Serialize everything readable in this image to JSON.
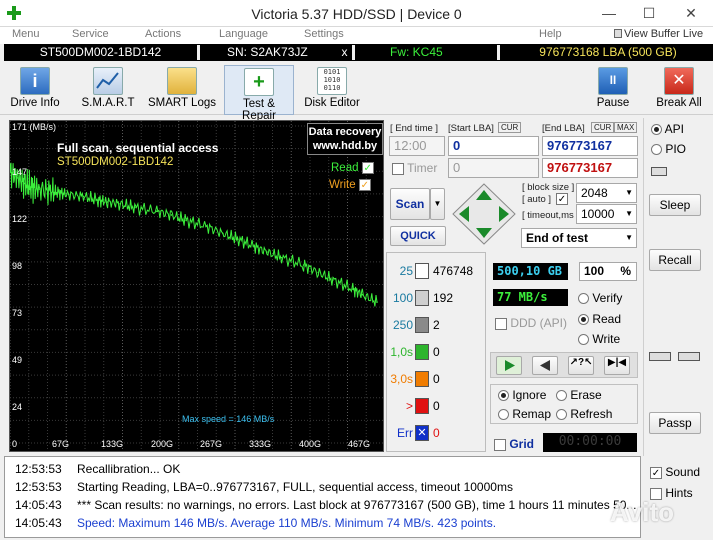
{
  "window": {
    "title": "Victoria 5.37 HDD/SSD | Device 0",
    "minimize": "—",
    "maximize": "☐",
    "close": "✕"
  },
  "menu": [
    "Menu",
    "Service",
    "Actions",
    "Language",
    "Settings",
    "Help"
  ],
  "view_buffer": "View Buffer Live",
  "device": {
    "model": "ST500DM002-1BD142",
    "serial": "SN: S2AK73JZ",
    "close": "x",
    "fw": "Fw: KC45",
    "lba": "976773168 LBA (500 GB)"
  },
  "toolbar": {
    "drive_info": "Drive Info",
    "smart": "S.M.A.R.T",
    "smart_logs": "SMART Logs",
    "test_repair": "Test & Repair",
    "disk_editor": "Disk Editor",
    "pause": "Pause",
    "break_all": "Break All"
  },
  "graph": {
    "y_top": "171 (MB/s)",
    "yticks": [
      "147",
      "122",
      "98",
      "73",
      "49",
      "24"
    ],
    "xticks": [
      "0",
      "67G",
      "133G",
      "200G",
      "267G",
      "333G",
      "400G",
      "467G"
    ],
    "title": "Full scan, sequential access",
    "model": "ST500DM002-1BD142",
    "badge_line1": "Data recovery",
    "badge_line2": "www.hdd.by",
    "read_label": "Read",
    "write_label": "Write",
    "max_speed": "Max speed = 146 MB/s"
  },
  "chart_data": {
    "type": "line",
    "title": "Full scan, sequential access",
    "xlabel": "",
    "ylabel": "MB/s",
    "xlim": [
      0,
      500
    ],
    "ylim": [
      0,
      171
    ],
    "series": [
      {
        "name": "Read",
        "x": [
          0,
          10,
          20,
          30,
          40,
          55,
          67,
          80,
          100,
          120,
          133,
          150,
          170,
          200,
          220,
          240,
          267,
          290,
          310,
          333,
          350,
          370,
          400,
          420,
          440,
          467,
          480,
          500
        ],
        "values": [
          146,
          143,
          140,
          138,
          137,
          136,
          135,
          134,
          133,
          131,
          130,
          129,
          127,
          125,
          123,
          120,
          117,
          113,
          110,
          106,
          103,
          100,
          96,
          92,
          88,
          83,
          80,
          76
        ]
      }
    ]
  },
  "lba_panel": {
    "end_time_label": "[ End time ]",
    "start_lba_label": "[Start LBA]",
    "cur_label": "CUR",
    "end_lba_label": "[End LBA]",
    "max_label": "MAX",
    "end_time": "12:00",
    "start_lba": "0",
    "end_lba": "976773167",
    "timer_label": "Timer",
    "timer_value": "0",
    "current_lba": "976773167",
    "block_size_label": "[ block size ]",
    "auto_label": "[ auto ]",
    "timeout_label": "[ timeout,ms ]",
    "block_size": "2048",
    "timeout": "10000",
    "end_action": "End of test"
  },
  "scan": {
    "scan": "Scan",
    "quick": "QUICK"
  },
  "counters": [
    {
      "label": "25",
      "value": "476748",
      "color": "#ffffff"
    },
    {
      "label": "100",
      "value": "192",
      "color": "#cfcfcf"
    },
    {
      "label": "250",
      "value": "2",
      "color": "#8a8a8a"
    },
    {
      "label": "1,0s",
      "value": "0",
      "color": "#2db52d"
    },
    {
      "label": "3,0s",
      "value": "0",
      "color": "#f07c00"
    },
    {
      "label": ">",
      "value": "0",
      "color": "#e01010"
    },
    {
      "label": "Err",
      "value": "0",
      "color": "#1030c8"
    }
  ],
  "status": {
    "size": "500,10 GB",
    "percent": "100",
    "pct_sign": "%",
    "speed": "77 MB/s",
    "ddd": "DDD (API)"
  },
  "mode": {
    "verify": "Verify",
    "read": "Read",
    "write": "Write"
  },
  "actions": {
    "ignore": "Ignore",
    "erase": "Erase",
    "remap": "Remap",
    "refresh": "Refresh"
  },
  "grid": {
    "label": "Grid",
    "time": "00:00:00"
  },
  "right_panel": {
    "api": "API",
    "pio": "PIO",
    "sleep": "Sleep",
    "recall": "Recall",
    "passp": "Passp",
    "sound": "Sound",
    "hints": "Hints"
  },
  "log": [
    {
      "time": "12:53:53",
      "text": "Recallibration... OK",
      "color": "#000000"
    },
    {
      "time": "12:53:53",
      "text": "Starting Reading, LBA=0..976773167, FULL, sequential access, timeout 10000ms",
      "color": "#000000"
    },
    {
      "time": "14:05:43",
      "text": "*** Scan results: no warnings, no errors. Last block at 976773167 (500 GB), time 1 hours 11 minutes 50...",
      "color": "#000000"
    },
    {
      "time": "14:05:43",
      "text": "Speed: Maximum 146 MB/s. Average 110 MB/s. Minimum 74 MB/s. 423 points.",
      "color": "#1a3fd0"
    }
  ],
  "watermark": "Avito"
}
